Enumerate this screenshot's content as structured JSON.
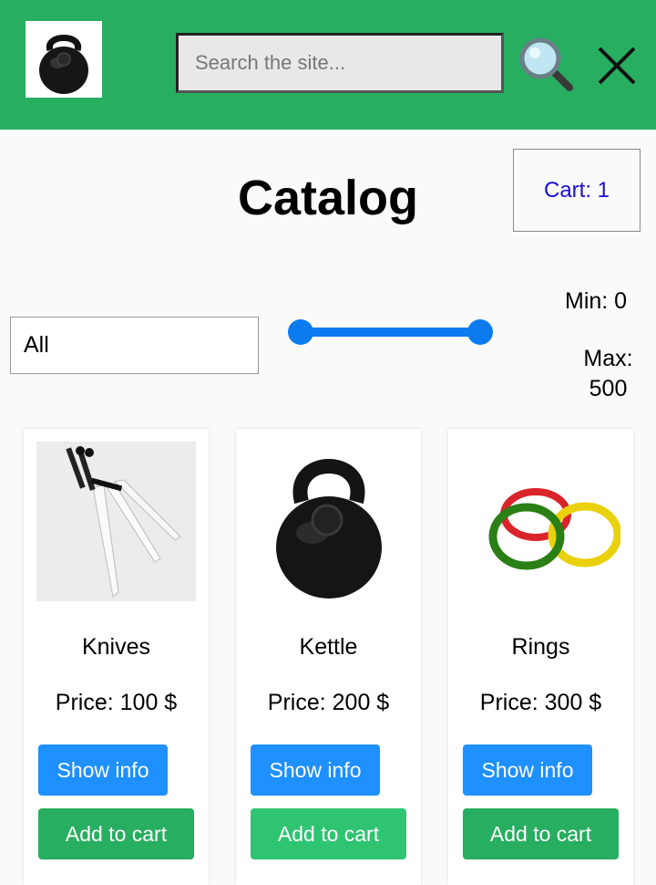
{
  "header": {
    "logo_icon": "kettlebell-icon",
    "search": {
      "placeholder": "Search the site...",
      "value": ""
    },
    "search_icon": "magnifier-icon",
    "close_icon": "close-icon",
    "background_color": "#27ae60"
  },
  "page": {
    "title": "Catalog",
    "cart_label": "Cart: 1"
  },
  "filters": {
    "category": "All",
    "price_range": {
      "min": 0,
      "max": 500
    },
    "min_label": "Min: 0",
    "max_label": "Max: 500",
    "slider_color": "#0d7bf0"
  },
  "products": [
    {
      "name": "Knives",
      "price": "Price: 100 $",
      "image_icon": "knives-icon",
      "info_label": "Show info",
      "cart_label": "Add to cart"
    },
    {
      "name": "Kettle",
      "price": "Price: 200 $",
      "image_icon": "kettlebell-icon",
      "info_label": "Show info",
      "cart_label": "Add to cart"
    },
    {
      "name": "Rings",
      "price": "Price: 300 $",
      "image_icon": "rings-icon",
      "info_label": "Show info",
      "cart_label": "Add to cart"
    }
  ],
  "colors": {
    "primary_button": "#1e90ff",
    "cart_button": "#27ae60",
    "cart_link": "#1a0dd6"
  }
}
